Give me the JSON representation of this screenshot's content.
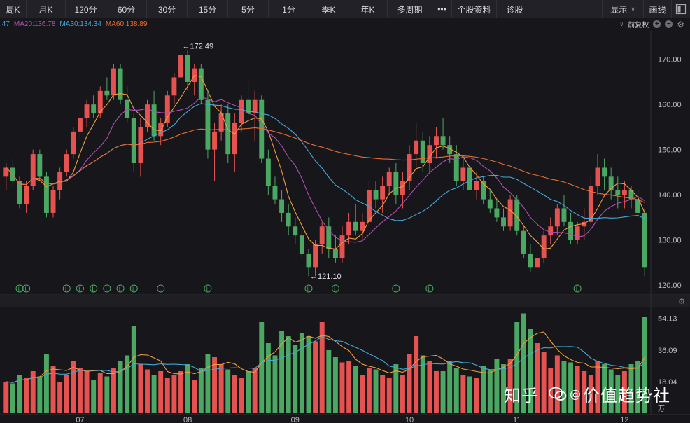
{
  "toolbar": {
    "tabs": [
      "周K",
      "月K",
      "120分",
      "60分",
      "30分",
      "15分",
      "5分",
      "1分",
      "季K",
      "年K",
      "多周期"
    ],
    "more": "•••",
    "profile": "个股资料",
    "diagnose": "诊股",
    "display": "显示",
    "draw": "画线"
  },
  "ma_legend": {
    "ma10": ".47",
    "ma20": "MA20:136.78",
    "ma30": "MA30:134.34",
    "ma60": "MA60:138.89"
  },
  "adjust": "前复权",
  "colors": {
    "up": "#e5524f",
    "down": "#4aa862",
    "ma10": "#f0a03c",
    "ma20": "#b14fb5",
    "ma30": "#45a9d9",
    "ma60": "#e96d31",
    "bg": "#17171b"
  },
  "price_axis": [
    "170.00",
    "160.00",
    "150.00",
    "140.00",
    "130.00",
    "120.00"
  ],
  "volume_axis": [
    "54.13",
    "36.09",
    "18.04"
  ],
  "volume_unit": "万",
  "months": [
    "07",
    "08",
    "09",
    "10",
    "11",
    "12"
  ],
  "annotations": {
    "high": "172.49",
    "low": "121.10",
    "high_arrow": "←",
    "low_arrow": "←"
  },
  "watermark": {
    "left": "知乎",
    "right": "价值趋势社",
    "at": "@"
  },
  "chart_data": {
    "type": "candlestick",
    "ylim": [
      118,
      176
    ],
    "volume_ylim": [
      0,
      60
    ],
    "candles": [
      [
        144,
        147,
        141,
        146,
        18
      ],
      [
        146,
        148,
        142,
        143,
        17
      ],
      [
        143,
        144,
        137,
        138,
        22
      ],
      [
        138,
        143,
        136,
        142,
        20
      ],
      [
        142,
        150,
        141,
        149,
        24
      ],
      [
        149,
        150,
        143,
        144,
        21
      ],
      [
        144,
        145,
        135,
        136,
        34
      ],
      [
        136,
        142,
        135,
        141,
        27
      ],
      [
        141,
        146,
        139,
        145,
        18
      ],
      [
        145,
        150,
        144,
        149,
        22
      ],
      [
        149,
        155,
        148,
        154,
        30
      ],
      [
        154,
        158,
        152,
        157,
        26
      ],
      [
        157,
        161,
        155,
        160,
        24
      ],
      [
        160,
        162,
        157,
        158,
        19
      ],
      [
        158,
        164,
        157,
        163,
        23
      ],
      [
        163,
        166,
        161,
        162,
        21
      ],
      [
        162,
        169,
        161,
        168,
        26
      ],
      [
        168,
        169,
        160,
        161,
        30
      ],
      [
        161,
        164,
        156,
        157,
        33
      ],
      [
        157,
        158,
        145,
        147,
        50
      ],
      [
        147,
        157,
        144,
        155,
        28
      ],
      [
        155,
        161,
        154,
        160,
        25
      ],
      [
        160,
        163,
        152,
        153,
        22
      ],
      [
        153,
        157,
        151,
        156,
        24
      ],
      [
        156,
        163,
        155,
        162,
        20
      ],
      [
        162,
        167,
        160,
        166,
        22
      ],
      [
        166,
        173,
        164,
        171,
        24
      ],
      [
        171,
        172,
        163,
        165,
        28
      ],
      [
        165,
        169,
        162,
        168,
        19
      ],
      [
        168,
        169,
        160,
        161,
        26
      ],
      [
        161,
        163,
        148,
        150,
        34
      ],
      [
        150,
        156,
        143,
        154,
        32
      ],
      [
        154,
        160,
        152,
        158,
        28
      ],
      [
        158,
        160,
        147,
        149,
        25
      ],
      [
        149,
        158,
        145,
        156,
        22
      ],
      [
        156,
        162,
        154,
        161,
        20
      ],
      [
        161,
        165,
        156,
        158,
        24
      ],
      [
        158,
        163,
        152,
        161,
        26
      ],
      [
        161,
        162,
        147,
        148,
        52
      ],
      [
        148,
        150,
        140,
        142,
        40
      ],
      [
        142,
        144,
        138,
        139,
        33
      ],
      [
        139,
        141,
        134,
        136,
        47
      ],
      [
        136,
        138,
        131,
        133,
        44
      ],
      [
        133,
        135,
        129,
        131,
        39
      ],
      [
        131,
        132,
        126,
        127,
        46
      ],
      [
        127,
        128,
        122,
        124,
        44
      ],
      [
        124,
        130,
        122,
        129,
        41
      ],
      [
        129,
        134,
        127,
        133,
        52
      ],
      [
        133,
        135,
        126,
        128,
        36
      ],
      [
        128,
        131,
        125,
        126,
        32
      ],
      [
        126,
        133,
        125,
        131,
        29
      ],
      [
        131,
        136,
        129,
        134,
        30
      ],
      [
        134,
        138,
        131,
        132,
        27
      ],
      [
        132,
        136,
        130,
        134,
        22
      ],
      [
        134,
        143,
        133,
        141,
        26
      ],
      [
        141,
        143,
        137,
        139,
        25
      ],
      [
        139,
        144,
        136,
        142,
        22
      ],
      [
        142,
        146,
        140,
        145,
        20
      ],
      [
        145,
        147,
        138,
        140,
        28
      ],
      [
        140,
        145,
        137,
        143,
        22
      ],
      [
        143,
        151,
        141,
        149,
        34
      ],
      [
        149,
        156,
        146,
        152,
        44
      ],
      [
        152,
        154,
        145,
        147,
        33
      ],
      [
        147,
        153,
        145,
        151,
        30
      ],
      [
        151,
        155,
        148,
        153,
        24
      ],
      [
        153,
        157,
        150,
        151,
        24
      ],
      [
        151,
        153,
        147,
        149,
        30
      ],
      [
        149,
        151,
        142,
        143,
        26
      ],
      [
        143,
        148,
        141,
        146,
        22
      ],
      [
        146,
        148,
        140,
        141,
        21
      ],
      [
        141,
        145,
        139,
        143,
        20
      ],
      [
        143,
        144,
        138,
        139,
        27
      ],
      [
        139,
        141,
        136,
        137,
        25
      ],
      [
        137,
        139,
        134,
        135,
        31
      ],
      [
        135,
        137,
        132,
        133,
        28
      ],
      [
        133,
        140,
        132,
        139,
        31
      ],
      [
        139,
        140,
        131,
        132,
        52
      ],
      [
        132,
        133,
        126,
        127,
        57
      ],
      [
        127,
        129,
        123,
        124,
        48
      ],
      [
        124,
        128,
        122,
        126,
        40
      ],
      [
        126,
        132,
        125,
        131,
        35
      ],
      [
        131,
        135,
        129,
        133,
        26
      ],
      [
        133,
        138,
        131,
        137,
        33
      ],
      [
        137,
        140,
        133,
        134,
        30
      ],
      [
        134,
        136,
        129,
        130,
        29
      ],
      [
        130,
        134,
        129,
        133,
        27
      ],
      [
        133,
        137,
        130,
        134,
        24
      ],
      [
        134,
        144,
        133,
        142,
        22
      ],
      [
        142,
        149,
        140,
        146,
        30
      ],
      [
        146,
        148,
        141,
        144,
        28
      ],
      [
        144,
        146,
        139,
        141,
        25
      ],
      [
        141,
        144,
        137,
        140,
        22
      ],
      [
        140,
        143,
        137,
        141,
        24
      ],
      [
        141,
        142,
        137,
        139,
        28
      ],
      [
        139,
        141,
        135,
        136,
        30
      ],
      [
        136,
        137,
        122,
        124,
        55
      ]
    ]
  }
}
